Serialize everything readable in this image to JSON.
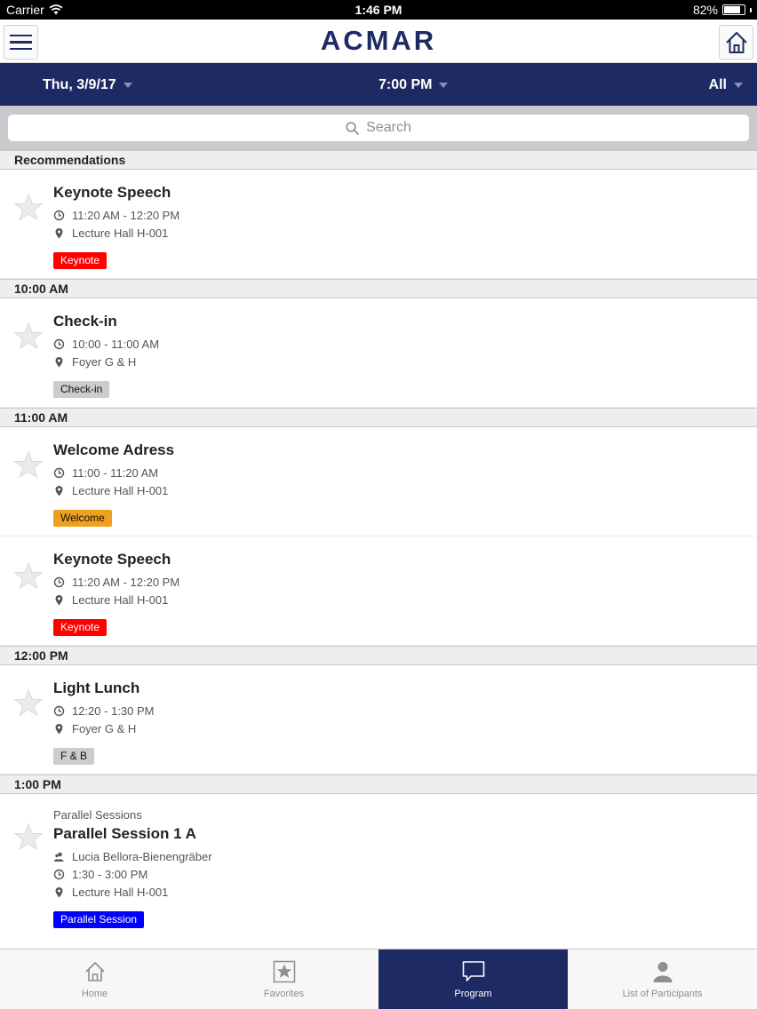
{
  "status_bar": {
    "carrier": "Carrier",
    "time": "1:46 PM",
    "battery": "82%",
    "battery_level": 0.82
  },
  "header": {
    "title": "ACMAR"
  },
  "filters": {
    "date": "Thu, 3/9/17",
    "time": "7:00 PM",
    "type": "All"
  },
  "search": {
    "placeholder": "Search"
  },
  "sections": [
    {
      "header": "Recommendations",
      "items": [
        {
          "title": "Keynote Speech",
          "time": "11:20 AM - 12:20 PM",
          "location": "Lecture Hall H-001",
          "tag": "Keynote"
        }
      ]
    },
    {
      "header": "10:00 AM",
      "items": [
        {
          "title": "Check-in",
          "time": "10:00 - 11:00 AM",
          "location": "Foyer G & H",
          "tag": "Check-in"
        }
      ]
    },
    {
      "header": "11:00 AM",
      "items": [
        {
          "title": "Welcome Adress",
          "time": "11:00 - 11:20 AM",
          "location": "Lecture Hall H-001",
          "tag": "Welcome"
        },
        {
          "title": "Keynote Speech",
          "time": "11:20 AM - 12:20 PM",
          "location": "Lecture Hall H-001",
          "tag": "Keynote"
        }
      ]
    },
    {
      "header": "12:00 PM",
      "items": [
        {
          "title": "Light Lunch",
          "time": "12:20 - 1:30 PM",
          "location": "Foyer G & H",
          "tag": "F & B"
        }
      ]
    },
    {
      "header": "1:00 PM",
      "items": [
        {
          "category": "Parallel Sessions",
          "title": "Parallel Session 1 A",
          "speaker": "Lucia Bellora-Bienengräber",
          "time": "1:30 - 3:00 PM",
          "location": "Lecture Hall H-001",
          "tag": "Parallel Session"
        }
      ]
    }
  ],
  "tabs": [
    {
      "label": "Home",
      "icon": "home-icon"
    },
    {
      "label": "Favorites",
      "icon": "star-icon"
    },
    {
      "label": "Program",
      "icon": "speech-bubble-icon",
      "active": true
    },
    {
      "label": "List of Participants",
      "icon": "person-icon"
    }
  ],
  "colors": {
    "brand": "#1e2a63",
    "keynote": "#ff0000",
    "welcome": "#f0a020",
    "parallel": "#0000ff",
    "neutral_tag": "#cccccc"
  }
}
